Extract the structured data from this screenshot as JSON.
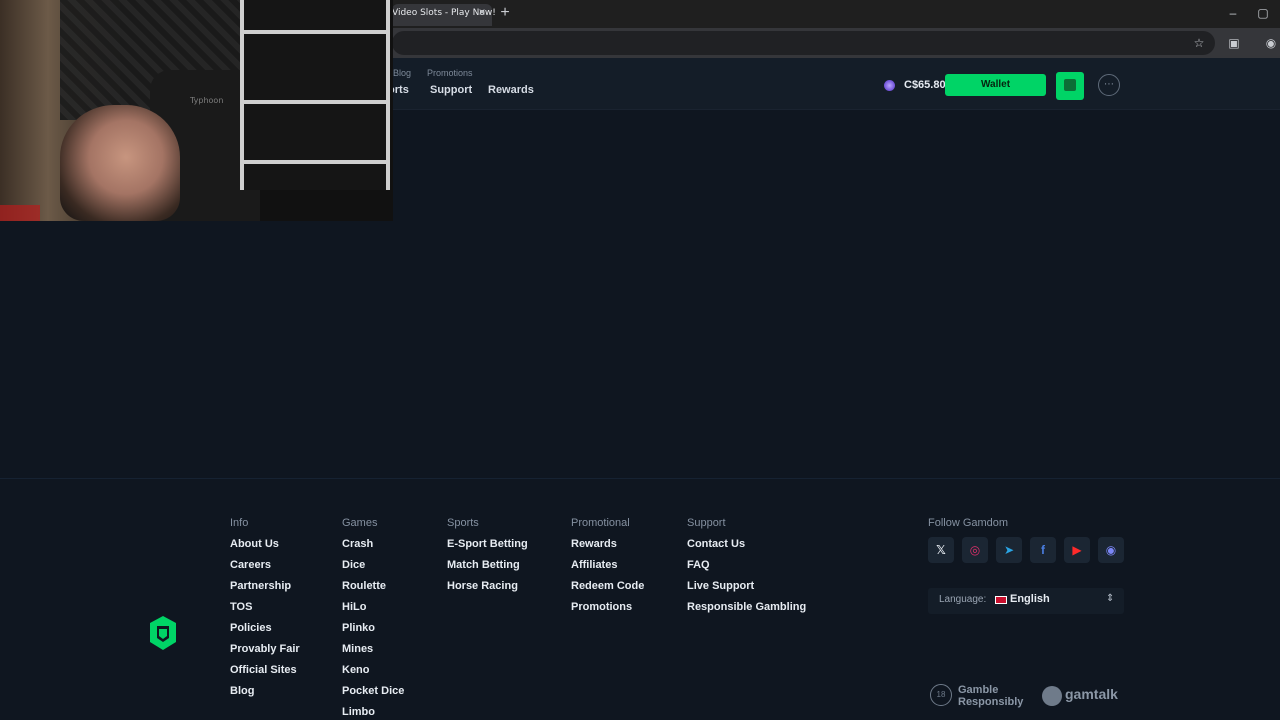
{
  "browser": {
    "tab_title": "Video Slots - Play Now!",
    "new_tab": "+",
    "close": "×",
    "minimize": "–",
    "restore": "▢"
  },
  "header": {
    "subnav": [
      "Blog",
      "Promotions"
    ],
    "nav": [
      "Sports",
      "Support",
      "Rewards"
    ],
    "balance": "C$65.80",
    "wallet_label": "Wallet"
  },
  "webcam": {
    "chair_text": "Typhoon"
  },
  "footer": {
    "columns": [
      {
        "title": "Info",
        "links": [
          "About Us",
          "Careers",
          "Partnership",
          "TOS",
          "Policies",
          "Provably Fair",
          "Official Sites",
          "Blog"
        ]
      },
      {
        "title": "Games",
        "links": [
          "Crash",
          "Dice",
          "Roulette",
          "HiLo",
          "Plinko",
          "Mines",
          "Keno",
          "Pocket Dice",
          "Limbo"
        ]
      },
      {
        "title": "Sports",
        "links": [
          "E-Sport Betting",
          "Match Betting",
          "Horse Racing"
        ]
      },
      {
        "title": "Promotional",
        "links": [
          "Rewards",
          "Affiliates",
          "Redeem Code",
          "Promotions"
        ]
      },
      {
        "title": "Support",
        "links": [
          "Contact Us",
          "FAQ",
          "Live Support",
          "Responsible Gambling"
        ]
      }
    ],
    "follow_title": "Follow Gamdom",
    "socials": [
      "x-icon",
      "instagram-icon",
      "telegram-icon",
      "facebook-icon",
      "youtube-icon",
      "discord-icon"
    ],
    "language_label": "Language:",
    "language_value": "English",
    "gamble_responsibly": "Gamble Responsibly",
    "badge_18": "18",
    "gamtalk": "gamtalk"
  },
  "colors": {
    "accent": "#00d466",
    "background": "#0f1620",
    "header": "#141d28"
  }
}
